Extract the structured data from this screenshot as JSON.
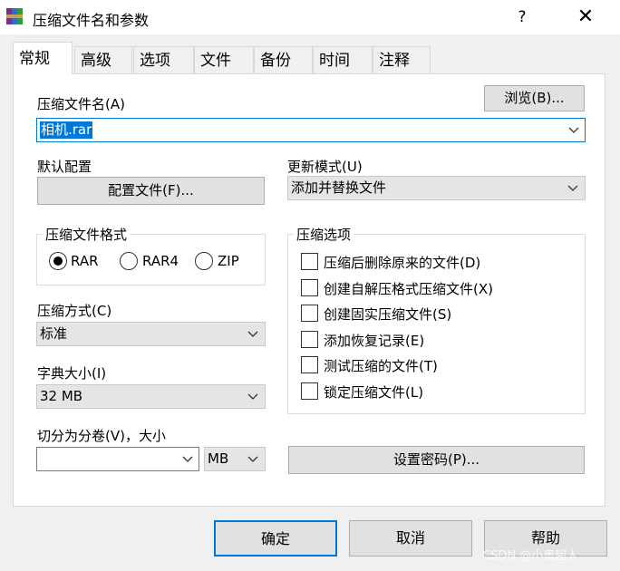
{
  "window": {
    "title": "压缩文件名和参数",
    "help_glyph": "?",
    "close_glyph": "✕"
  },
  "tabs": [
    {
      "label": "常规"
    },
    {
      "label": "高级"
    },
    {
      "label": "选项"
    },
    {
      "label": "文件"
    },
    {
      "label": "备份"
    },
    {
      "label": "时间"
    },
    {
      "label": "注释"
    }
  ],
  "archive_name": {
    "label": "压缩文件名(A)",
    "value": "相机.rar",
    "browse_button": "浏览(B)..."
  },
  "profile": {
    "label": "默认配置",
    "button": "配置文件(F)..."
  },
  "update_mode": {
    "label": "更新模式(U)",
    "value": "添加并替换文件"
  },
  "format": {
    "title": "压缩文件格式",
    "options": [
      {
        "label": "RAR",
        "checked": true
      },
      {
        "label": "RAR4",
        "checked": false
      },
      {
        "label": "ZIP",
        "checked": false
      }
    ]
  },
  "method": {
    "label": "压缩方式(C)",
    "value": "标准"
  },
  "dictionary": {
    "label": "字典大小(I)",
    "value": "32 MB"
  },
  "split": {
    "label": "切分为分卷(V)，大小",
    "value": "",
    "unit": "MB"
  },
  "options": {
    "title": "压缩选项",
    "items": [
      {
        "label": "压缩后删除原来的文件(D)",
        "checked": false
      },
      {
        "label": "创建自解压格式压缩文件(X)",
        "checked": false
      },
      {
        "label": "创建固实压缩文件(S)",
        "checked": false
      },
      {
        "label": "添加恢复记录(E)",
        "checked": false
      },
      {
        "label": "测试压缩的文件(T)",
        "checked": false
      },
      {
        "label": "锁定压缩文件(L)",
        "checked": false
      }
    ]
  },
  "password_button": "设置密码(P)...",
  "footer": {
    "ok": "确定",
    "cancel": "取消",
    "help": "帮助"
  },
  "watermark": "CSDN @小奥超人"
}
